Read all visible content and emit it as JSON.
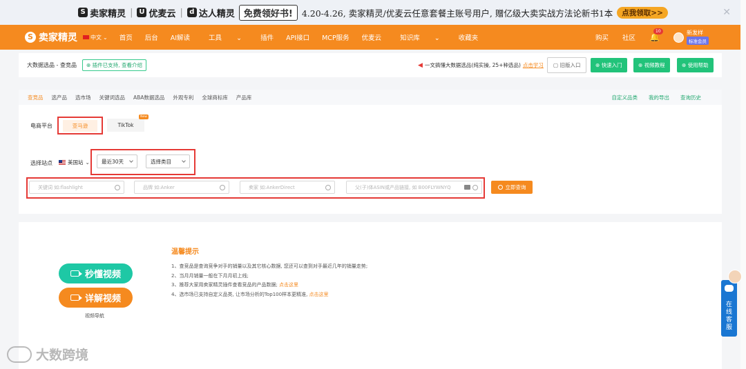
{
  "promo": {
    "brand1": "卖家精灵",
    "brand2": "优麦云",
    "brand3": "达人精灵",
    "free_label": "免费领好书!",
    "text": "4.20-4.26, 卖家精灵/优麦云任意套餐主账号用户, 赠亿级大卖实战方法论新书1本",
    "cta": "点我领取>>",
    "close_icon": "close-icon"
  },
  "nav": {
    "logo": "卖家精灵",
    "lang": "中文",
    "menu": [
      "首页",
      "后台",
      "AI解读",
      "工具",
      "插件",
      "API接口",
      "MCP服务",
      "优麦云",
      "知识库",
      "收藏夹"
    ],
    "buy": "购买",
    "community": "社区",
    "bell_count": "10",
    "user_name": "新发样",
    "member_badge": "标准会员"
  },
  "header": {
    "breadcrumb": "大数据选品 - 查竞品",
    "plugin_badge": "插件已支持, 查看介绍",
    "tip_text": "一文搞懂大数据选品(纯实操, 25+种选品)",
    "tip_link": "点击学习",
    "old_entry": "旧版入口",
    "quick_entry": "快速入门",
    "video_tutorial": "视频教程",
    "help": "使用帮助"
  },
  "tabs": {
    "items": [
      "查竞品",
      "选产品",
      "选市场",
      "关键词选品",
      "ABA数据选品",
      "外观专利",
      "全球商标库",
      "产品库"
    ],
    "right": [
      "自定义品类",
      "我的导出",
      "查询历史"
    ]
  },
  "filters": {
    "platform_label": "电商平台",
    "platform_amazon": "亚马逊",
    "platform_tiktok": "TikTok",
    "new_badge": "New",
    "site_label": "选择站点",
    "site_value": "美国站",
    "period": "最近30天",
    "category": "选择类目",
    "keyword_placeholder": "关键词 如:flashlight",
    "brand_placeholder": "品牌 如:Anker",
    "seller_placeholder": "卖家 如:AnkerDirect",
    "asin_placeholder": "父(子)体ASIN或产品链接, 如 B00FLYWNYQ",
    "search_button": "立即查询"
  },
  "lower": {
    "btn_quick_video": "秒懂视频",
    "btn_detail_video": "详解视频",
    "video_nav": "视频导航",
    "tips_title": "温馨提示",
    "tips": [
      "1、查竞品是查询竞争对手的销量以及其它核心数据, 您还可以查到对手最近几年的销量走势;",
      "2、当月月销量一般在下月月初上线;",
      "3、推荐大家用卖家精灵插件查看竞品的产品数据; ",
      "4、选市场已支持自定义品类, 让市场分析的Top100样本更精准, "
    ],
    "tip3_link": "点击这里",
    "tip4_link": "点击这里"
  },
  "side": {
    "chat_label": "在线客服"
  },
  "watermark": "大数跨境",
  "colors": {
    "brand_orange": "#f58a1f",
    "green": "#22c37a",
    "teal": "#1ec8a5",
    "highlight_red": "#e53935"
  }
}
